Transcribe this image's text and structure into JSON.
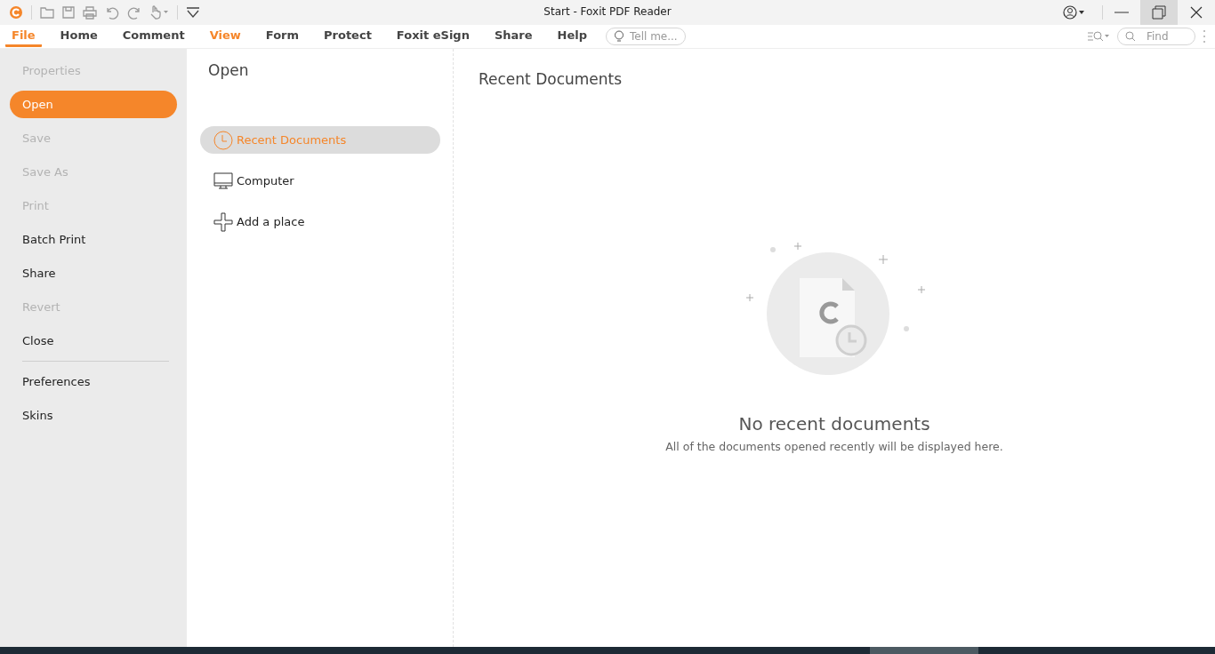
{
  "window": {
    "title": "Start - Foxit PDF Reader"
  },
  "menu_tabs": [
    {
      "label": "File",
      "selected": true,
      "highlighted": false
    },
    {
      "label": "Home",
      "selected": false,
      "highlighted": false
    },
    {
      "label": "Comment",
      "selected": false,
      "highlighted": false
    },
    {
      "label": "View",
      "selected": false,
      "highlighted": true
    },
    {
      "label": "Form",
      "selected": false,
      "highlighted": false
    },
    {
      "label": "Protect",
      "selected": false,
      "highlighted": false
    },
    {
      "label": "Foxit eSign",
      "selected": false,
      "highlighted": false
    },
    {
      "label": "Share",
      "selected": false,
      "highlighted": false
    },
    {
      "label": "Help",
      "selected": false,
      "highlighted": false
    }
  ],
  "tell_me": {
    "placeholder": "Tell me..."
  },
  "find": {
    "placeholder": "Find"
  },
  "sidebar": {
    "items": [
      {
        "label": "Properties",
        "disabled": true,
        "selected": false,
        "separator_before": false
      },
      {
        "label": "Open",
        "disabled": false,
        "selected": true,
        "separator_before": false
      },
      {
        "label": "Save",
        "disabled": true,
        "selected": false,
        "separator_before": false
      },
      {
        "label": "Save As",
        "disabled": true,
        "selected": false,
        "separator_before": false
      },
      {
        "label": "Print",
        "disabled": true,
        "selected": false,
        "separator_before": false
      },
      {
        "label": "Batch Print",
        "disabled": false,
        "selected": false,
        "separator_before": false
      },
      {
        "label": "Share",
        "disabled": false,
        "selected": false,
        "separator_before": false
      },
      {
        "label": "Revert",
        "disabled": true,
        "selected": false,
        "separator_before": false
      },
      {
        "label": "Close",
        "disabled": false,
        "selected": false,
        "separator_before": false
      },
      {
        "label": "Preferences",
        "disabled": false,
        "selected": false,
        "separator_before": true
      },
      {
        "label": "Skins",
        "disabled": false,
        "selected": false,
        "separator_before": false
      }
    ]
  },
  "open_panel": {
    "title": "Open",
    "places": [
      {
        "kind": "recent",
        "label": "Recent Documents",
        "selected": true
      },
      {
        "kind": "computer",
        "label": "Computer",
        "selected": false
      },
      {
        "kind": "add",
        "label": "Add a place",
        "selected": false
      }
    ]
  },
  "recent": {
    "title": "Recent Documents",
    "empty_title": "No recent documents",
    "empty_text": "All of the documents opened recently will be displayed here."
  }
}
